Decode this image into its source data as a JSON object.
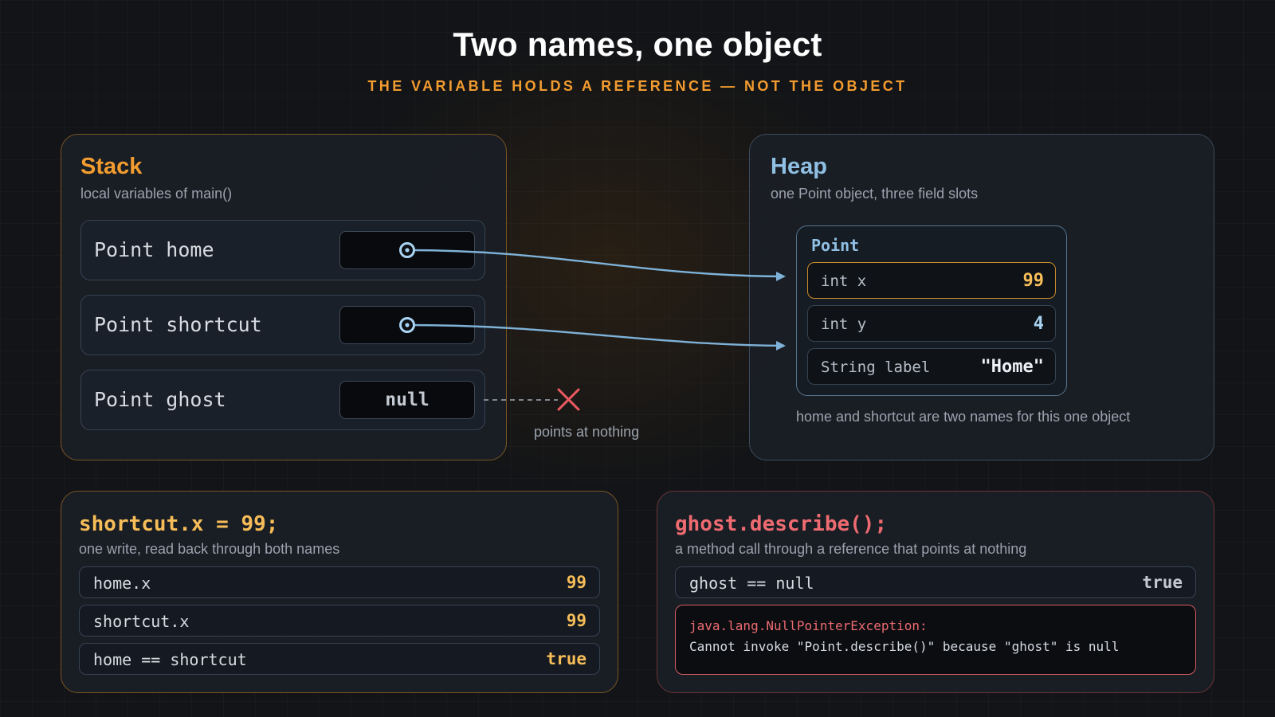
{
  "title": "Two names, one object",
  "subtitle": "THE VARIABLE HOLDS A REFERENCE — NOT THE OBJECT",
  "colors": {
    "accent_orange": "#f39c2f",
    "heap_blue": "#8fc0e4",
    "arrow_blue": "#7fb2d8",
    "error_red": "#ee6b71",
    "value_yellow": "#f6bd58"
  },
  "stack": {
    "title": "Stack",
    "subtitle": "local variables of main()",
    "vars": [
      {
        "label": "Point home",
        "value": ""
      },
      {
        "label": "Point shortcut",
        "value": ""
      },
      {
        "label": "Point ghost",
        "value": "null"
      }
    ]
  },
  "null_note": "points at nothing",
  "heap": {
    "title": "Heap",
    "subtitle": "one Point object, three field slots",
    "object": {
      "name": "Point",
      "fields": [
        {
          "label": "int x",
          "value": "99"
        },
        {
          "label": "int y",
          "value": "4"
        },
        {
          "label": "String label",
          "value": "\"Home\""
        }
      ]
    },
    "note": "home and shortcut are two names for this one object"
  },
  "assign": {
    "code": "shortcut.x = 99;",
    "subtitle": "one write, read back through both names",
    "rows": [
      {
        "label": "home.x",
        "value": "99"
      },
      {
        "label": "shortcut.x",
        "value": "99"
      },
      {
        "label": "home == shortcut",
        "value": "true"
      }
    ]
  },
  "call": {
    "code": "ghost.describe();",
    "subtitle": "a method call through a reference that points at nothing",
    "check": {
      "label": "ghost == null",
      "value": "true"
    },
    "error_type": "java.lang.NullPointerException:",
    "error_message": "Cannot invoke \"Point.describe()\" because \"ghost\" is null"
  }
}
